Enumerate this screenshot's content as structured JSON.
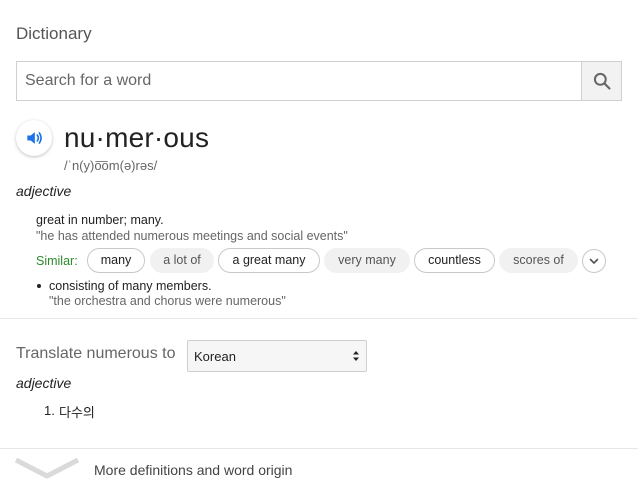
{
  "header": {
    "title": "Dictionary"
  },
  "search": {
    "placeholder": "Search for a word",
    "value": "",
    "icon": "search-icon"
  },
  "entry": {
    "headword": "nu·mer·ous",
    "phonetic": "/ˈn(y)o͞om(ə)rəs/",
    "audio_icon": "speaker-icon",
    "part_of_speech": "adjective",
    "senses": [
      {
        "definition": "great in number; many.",
        "example": "\"he has attended numerous meetings and social events\"",
        "similar_label": "Similar:",
        "similar": [
          {
            "word": "many",
            "style": "outlined"
          },
          {
            "word": "a lot of",
            "style": "plain"
          },
          {
            "word": "a great many",
            "style": "outlined"
          },
          {
            "word": "very many",
            "style": "plain"
          },
          {
            "word": "countless",
            "style": "outlined"
          },
          {
            "word": "scores of",
            "style": "plain"
          }
        ],
        "expand_icon": "chevron-down-icon"
      },
      {
        "definition": "consisting of many members.",
        "example": "\"the orchestra and chorus were numerous\""
      }
    ]
  },
  "translate": {
    "label": "Translate numerous to",
    "language": "Korean",
    "part_of_speech": "adjective",
    "results": [
      {
        "number": "1.",
        "word": "다수의"
      }
    ]
  },
  "footer": {
    "more_label": "More definitions and word origin",
    "chevron_icon": "chevron-down-icon"
  },
  "colors": {
    "accent_blue": "#1a73e8",
    "similar_green": "#2e8a2e",
    "text_primary": "#222222",
    "text_secondary": "#666666"
  }
}
